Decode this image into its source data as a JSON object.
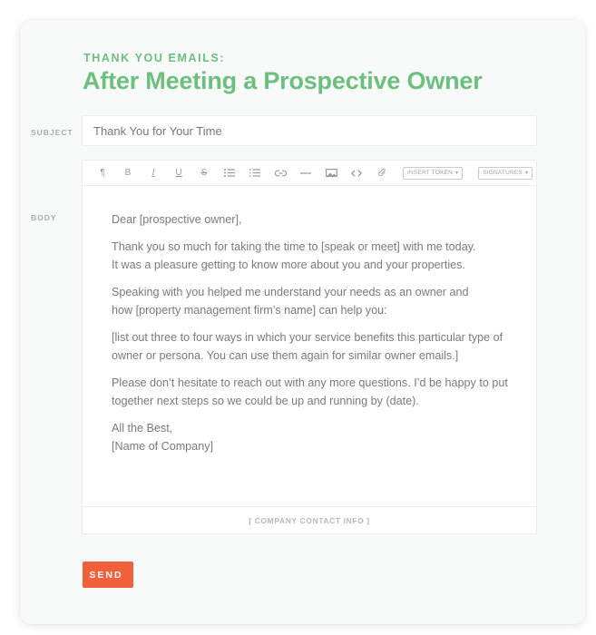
{
  "header": {
    "eyebrow": "THANK YOU EMAILS:",
    "title": "After Meeting a Prospective Owner"
  },
  "form": {
    "subject_label": "SUBJECT",
    "subject_value": "Thank You for Your Time",
    "body_label": "BODY"
  },
  "toolbar": {
    "buttons": [
      {
        "name": "paragraph",
        "glyph": "¶"
      },
      {
        "name": "bold",
        "glyph": "B"
      },
      {
        "name": "italic",
        "glyph": "I"
      },
      {
        "name": "underline",
        "glyph": "U"
      },
      {
        "name": "strikethrough",
        "glyph": "S"
      },
      {
        "name": "unordered-list"
      },
      {
        "name": "ordered-list"
      },
      {
        "name": "link"
      },
      {
        "name": "horizontal-rule"
      },
      {
        "name": "image"
      },
      {
        "name": "code"
      },
      {
        "name": "attachment"
      }
    ],
    "insert_token_label": "INSERT TOKEN",
    "signatures_label": "SIGNATURES",
    "caret": "▾"
  },
  "email_body": {
    "greeting": "Dear [prospective owner],",
    "paragraph_1_line_1": "Thank you so much for taking the time to [speak or meet] with me today.",
    "paragraph_1_line_2": "It was a pleasure getting to know more about you and your properties.",
    "paragraph_2_line_1": "Speaking with you helped me understand your needs as an owner and",
    "paragraph_2_line_2": "how [property management firm’s name] can help you:",
    "paragraph_3": "[list out three to four ways in which your service benefits this particular type of owner or persona. You can use them again for similar owner emails.]",
    "paragraph_4": "Please don’t hesitate to reach out with any more questions. I’d be happy to put together next steps so we could be up and running by (date).",
    "closing": "All the Best,",
    "signature": "[Name of Company]"
  },
  "footer_info": "[ COMPANY CONTACT INFO ]",
  "send_label": "SEND",
  "colors": {
    "accent_green": "#6cbf7e",
    "send_orange": "#f2603b"
  }
}
